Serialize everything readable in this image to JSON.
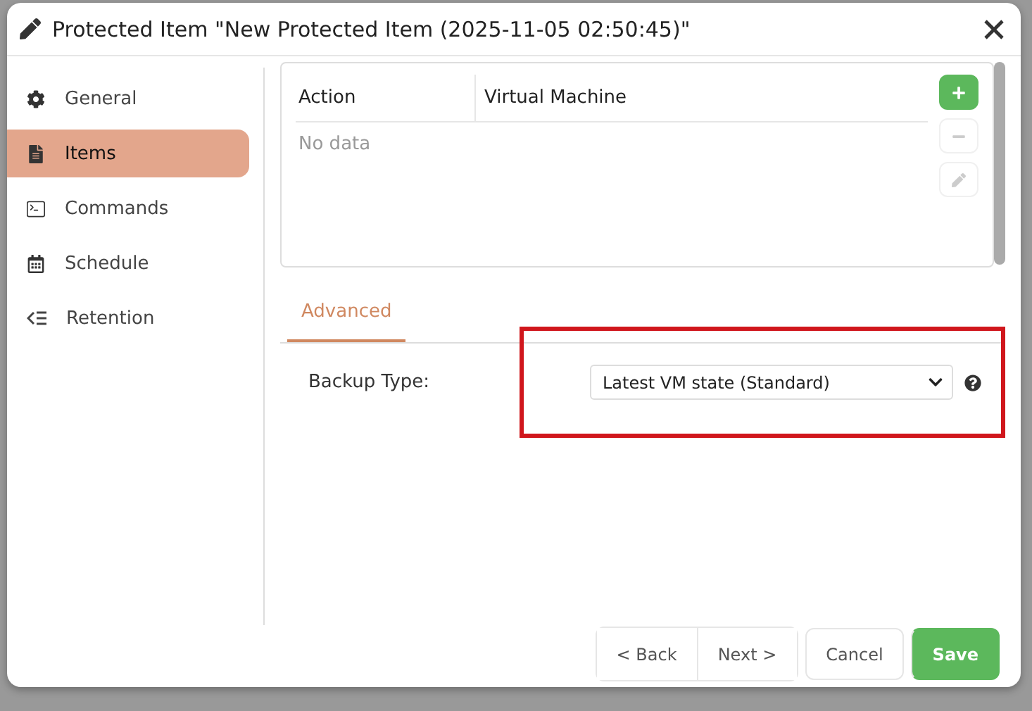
{
  "window": {
    "title": "Protected Item \"New Protected Item (2025-11-05 02:50:45)\""
  },
  "sidebar": {
    "items": [
      {
        "label": "General",
        "kind": "gear",
        "selected": false
      },
      {
        "label": "Items",
        "kind": "file",
        "selected": true
      },
      {
        "label": "Commands",
        "kind": "terminal",
        "selected": false
      },
      {
        "label": "Schedule",
        "kind": "calendar",
        "selected": false
      },
      {
        "label": "Retention",
        "kind": "retention",
        "selected": false
      }
    ]
  },
  "table": {
    "columns": [
      "Action",
      "Virtual Machine"
    ],
    "empty_text": "No data",
    "tools": [
      {
        "kind": "add",
        "disabled": false
      },
      {
        "kind": "remove",
        "disabled": true
      },
      {
        "kind": "edit",
        "disabled": true
      }
    ]
  },
  "tabs": [
    {
      "label": "Advanced",
      "selected": true
    }
  ],
  "backup_type": {
    "label": "Backup Type:",
    "value": "Latest VM state (Standard)",
    "highlighted": true
  },
  "buttons": [
    {
      "label": "< Back",
      "kind": "nav"
    },
    {
      "label": "Next >",
      "kind": "nav"
    },
    {
      "label": "Cancel",
      "kind": "plain"
    },
    {
      "label": "Save",
      "kind": "primary"
    }
  ]
}
